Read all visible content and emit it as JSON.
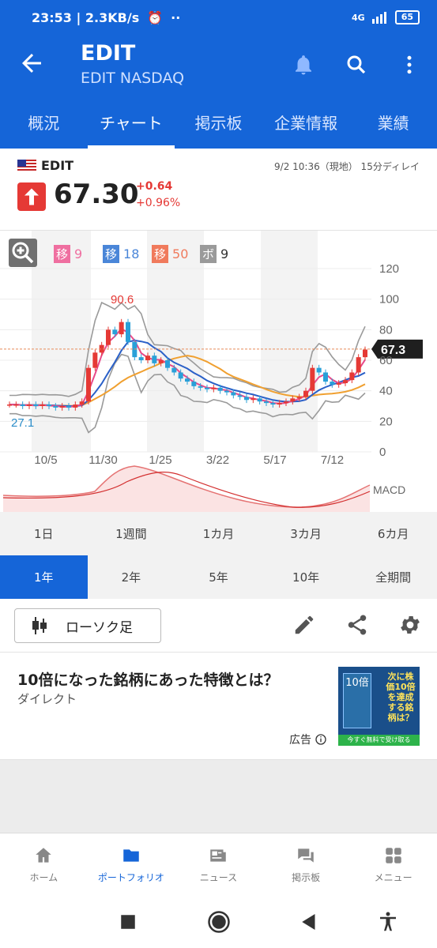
{
  "status": {
    "time": "23:53",
    "speed": "2.3KB/s",
    "network": "4G",
    "battery": "65"
  },
  "header": {
    "title": "EDIT",
    "subtitle": "EDIT NASDAQ"
  },
  "tabs": [
    "概況",
    "チャート",
    "掲示板",
    "企業情報",
    "業績"
  ],
  "active_tab": 1,
  "quote": {
    "symbol": "EDIT",
    "timestamp": "9/2 10:36（現地） 15分ディレイ",
    "price": "67.30",
    "change": "+0.64",
    "change_pct": "+0.96%"
  },
  "legend": [
    {
      "tag": "移",
      "value": "9",
      "color": "#ef6fa0"
    },
    {
      "tag": "移",
      "value": "18",
      "color": "#4a86d8"
    },
    {
      "tag": "移",
      "value": "50",
      "color": "#f07a5c"
    },
    {
      "tag": "ボ",
      "value": "9",
      "color": "#9a9a9a"
    }
  ],
  "chart_data": {
    "type": "candlestick",
    "y_ticks": [
      "120",
      "100",
      "80",
      "60",
      "40",
      "20",
      "0"
    ],
    "ylim": [
      0,
      120
    ],
    "x_ticks": [
      "10/5",
      "11/30",
      "1/25",
      "3/22",
      "5/17",
      "7/12"
    ],
    "high_label": "90.6",
    "low_label": "27.1",
    "last_price_label": "67.3",
    "macd_label": "MACD",
    "close_series": [
      31,
      31,
      30,
      31,
      30,
      31,
      30,
      29,
      30,
      29,
      31,
      33,
      55,
      65,
      70,
      80,
      77,
      85,
      72,
      62,
      60,
      63,
      58,
      60,
      55,
      52,
      48,
      46,
      43,
      42,
      41,
      42,
      40,
      39,
      37,
      36,
      34,
      35,
      33,
      32,
      31,
      32,
      33,
      35,
      36,
      40,
      55,
      52,
      46,
      44,
      45,
      47,
      52,
      62,
      67
    ]
  },
  "periods": {
    "row1": [
      "1日",
      "1週間",
      "1カ月",
      "3カ月",
      "6カ月"
    ],
    "row2": [
      "1年",
      "2年",
      "5年",
      "10年",
      "全期間"
    ],
    "active": "1年"
  },
  "chart_type_button": "ローソク足",
  "ad": {
    "headline": "10倍になった銘柄にあった特徴とは？",
    "sponsor": "ダイレクト",
    "label": "広告",
    "thumb_text": "次に株価10倍を達成する銘柄は？",
    "thumb_book": "10倍",
    "thumb_cta": "今すぐ無料で受け取る"
  },
  "bottom_nav": [
    "ホーム",
    "ポートフォリオ",
    "ニュース",
    "掲示板",
    "メニュー"
  ],
  "bottom_nav_active": 1
}
